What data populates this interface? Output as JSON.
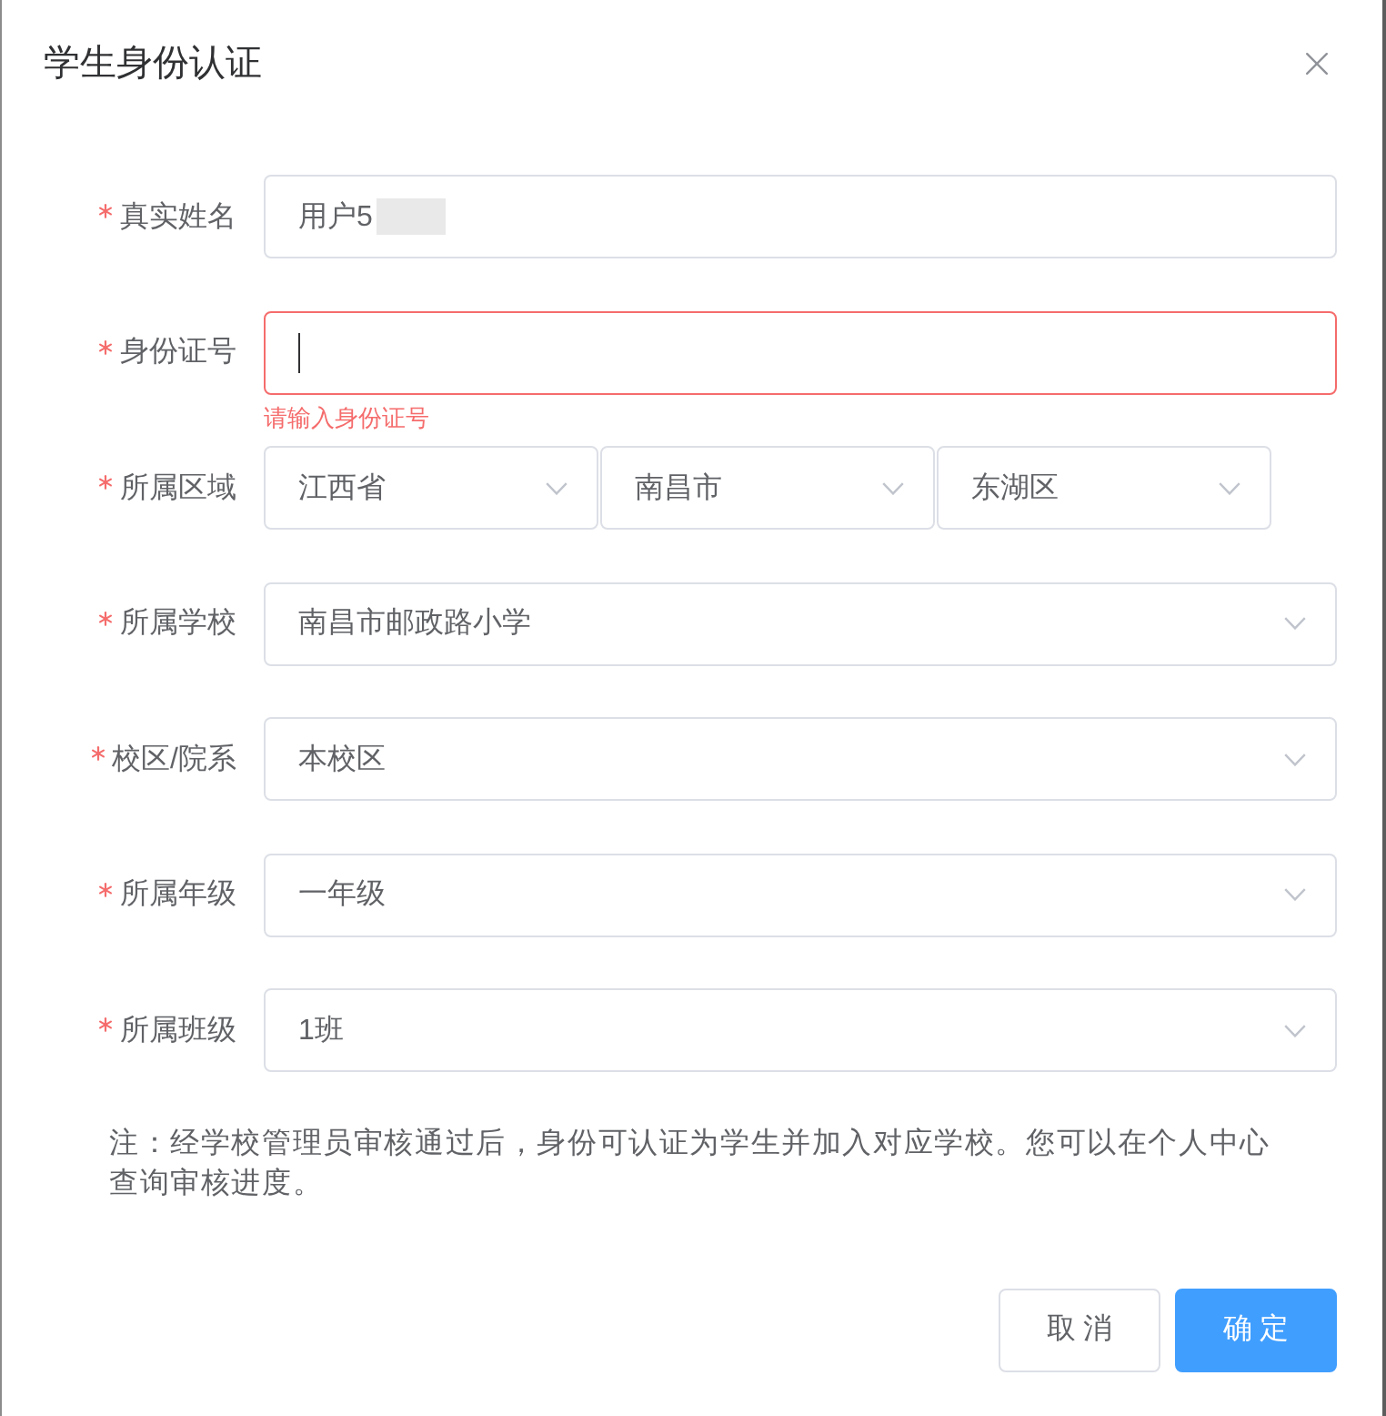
{
  "dialog": {
    "title": "学生身份认证"
  },
  "form": {
    "fields": [
      {
        "kind": "text",
        "label": "真实姓名",
        "required": true,
        "value": "用户5",
        "redacted": true
      },
      {
        "kind": "text",
        "label": "身份证号",
        "required": true,
        "focused": true,
        "error": "请输入身份证号"
      },
      {
        "kind": "cascade",
        "label": "所属区域",
        "required": true,
        "values": [
          "江西省",
          "南昌市",
          "东湖区"
        ]
      },
      {
        "kind": "select",
        "label": "所属学校",
        "required": true,
        "value": "南昌市邮政路小学"
      },
      {
        "kind": "select",
        "label": "校区/院系",
        "required": true,
        "value": "本校区"
      },
      {
        "kind": "select",
        "label": "所属年级",
        "required": true,
        "value": "一年级"
      },
      {
        "kind": "select",
        "label": "所属班级",
        "required": true,
        "value": "1班"
      }
    ]
  },
  "note": "注：经学校管理员审核通过后，身份可认证为学生并加入对应学校。您可以在个人中心查询审核进度。",
  "buttons": [
    {
      "kind": "default",
      "label": "取 消"
    },
    {
      "kind": "primary",
      "label": "确 定"
    }
  ]
}
